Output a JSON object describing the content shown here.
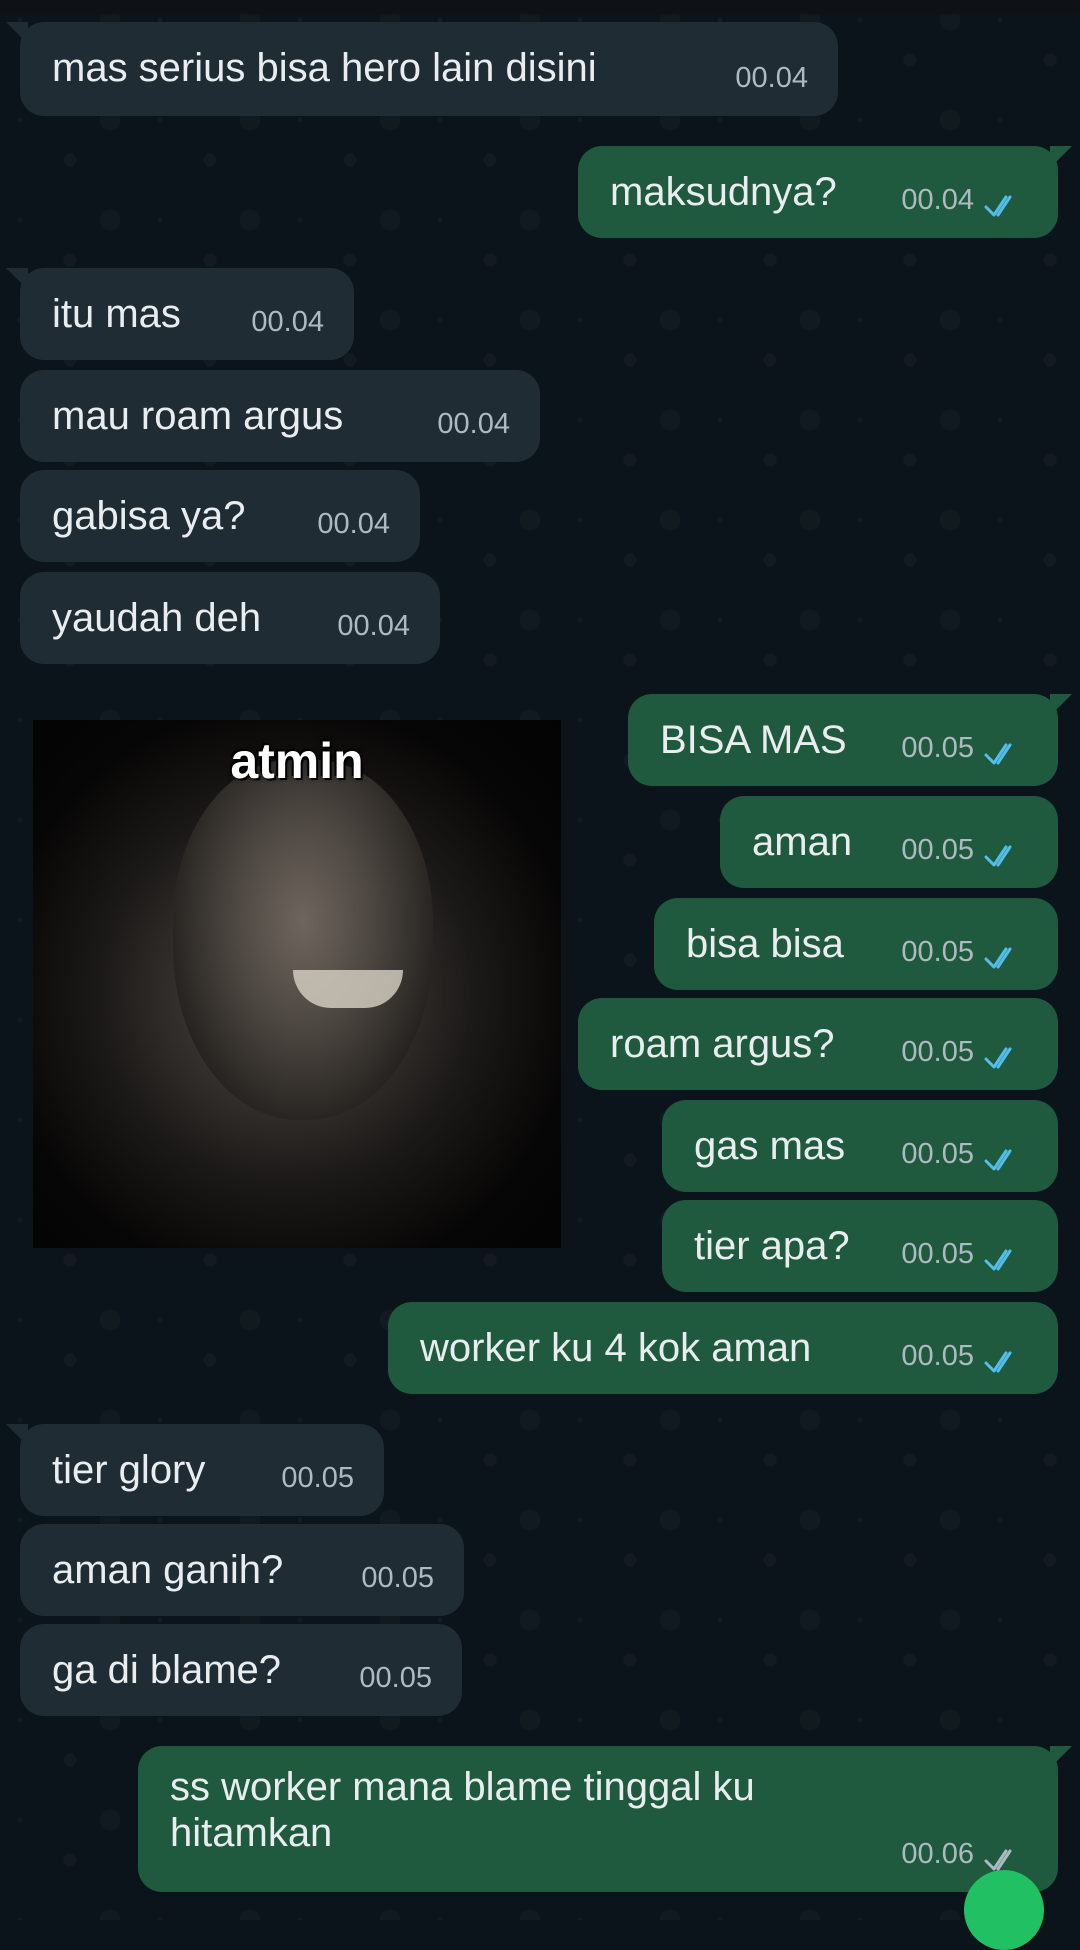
{
  "messages": [
    {
      "dir": "in",
      "text": "mas serius bisa hero lain disini",
      "time": "00.04"
    },
    {
      "dir": "out",
      "text": "maksudnya?",
      "time": "00.04",
      "read": true
    },
    {
      "dir": "in",
      "text": "itu mas",
      "time": "00.04"
    },
    {
      "dir": "in",
      "text": "mau roam argus",
      "time": "00.04"
    },
    {
      "dir": "in",
      "text": "gabisa ya?",
      "time": "00.04"
    },
    {
      "dir": "in",
      "text": "yaudah deh",
      "time": "00.04"
    },
    {
      "dir": "out",
      "text": "BISA MAS",
      "time": "00.05",
      "read": true
    },
    {
      "dir": "out",
      "text": "aman",
      "time": "00.05",
      "read": true
    },
    {
      "dir": "out",
      "text": "bisa bisa",
      "time": "00.05",
      "read": true
    },
    {
      "dir": "out",
      "text": "roam argus?",
      "time": "00.05",
      "read": true
    },
    {
      "dir": "out",
      "text": "gas mas",
      "time": "00.05",
      "read": true
    },
    {
      "dir": "out",
      "text": "tier apa?",
      "time": "00.05",
      "read": true
    },
    {
      "dir": "out",
      "text": "worker ku 4 kok aman",
      "time": "00.05",
      "read": true
    },
    {
      "dir": "in",
      "text": "tier glory",
      "time": "00.05"
    },
    {
      "dir": "in",
      "text": "aman ganih?",
      "time": "00.05"
    },
    {
      "dir": "in",
      "text": "ga di blame?",
      "time": "00.05"
    },
    {
      "dir": "out",
      "text": "ss worker mana blame tinggal ku hitamkan",
      "time": "00.06",
      "read": false
    }
  ],
  "sticker": {
    "caption": "atmin"
  },
  "colors": {
    "background": "#0b141a",
    "incoming_bubble": "#202c33",
    "outgoing_bubble": "#1f5a3e",
    "read_ticks": "#53bdeb",
    "unread_ticks": "#aebac1",
    "fab": "#21c063"
  },
  "icons": {
    "read_ticks": "double-check-icon",
    "fab": "fab-button"
  }
}
